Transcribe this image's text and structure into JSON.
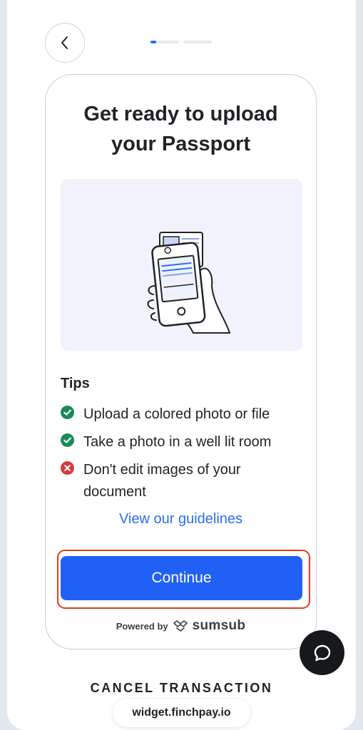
{
  "header": {
    "back_icon": "chevron-left-icon",
    "progress": {
      "segments": 2,
      "current_step": 1,
      "current_fill": 0.2
    }
  },
  "card": {
    "title": "Get ready to upload your Passport",
    "illustration": "hand-holding-phone-passport-illustration",
    "tips_title": "Tips",
    "tips": [
      {
        "text": "Upload a colored photo or file",
        "status": "ok",
        "icon": "check-circle-icon"
      },
      {
        "text": "Take a photo in a well lit room",
        "status": "ok",
        "icon": "check-circle-icon"
      },
      {
        "text": "Don't edit images of your document",
        "status": "bad",
        "icon": "x-circle-icon"
      }
    ],
    "guidelines_link": "View our guidelines",
    "continue_label": "Continue",
    "powered_by": "Powered by",
    "brand": "sumsub"
  },
  "chat_icon": "chat-bubble-icon",
  "cancel_label": "CANCEL TRANSACTION",
  "domain": "widget.finchpay.io",
  "colors": {
    "accent": "#2160f5",
    "link": "#2a6ef6",
    "ok": "#1a8a5a",
    "bad": "#d63a3a",
    "highlight": "#e33b1f"
  }
}
